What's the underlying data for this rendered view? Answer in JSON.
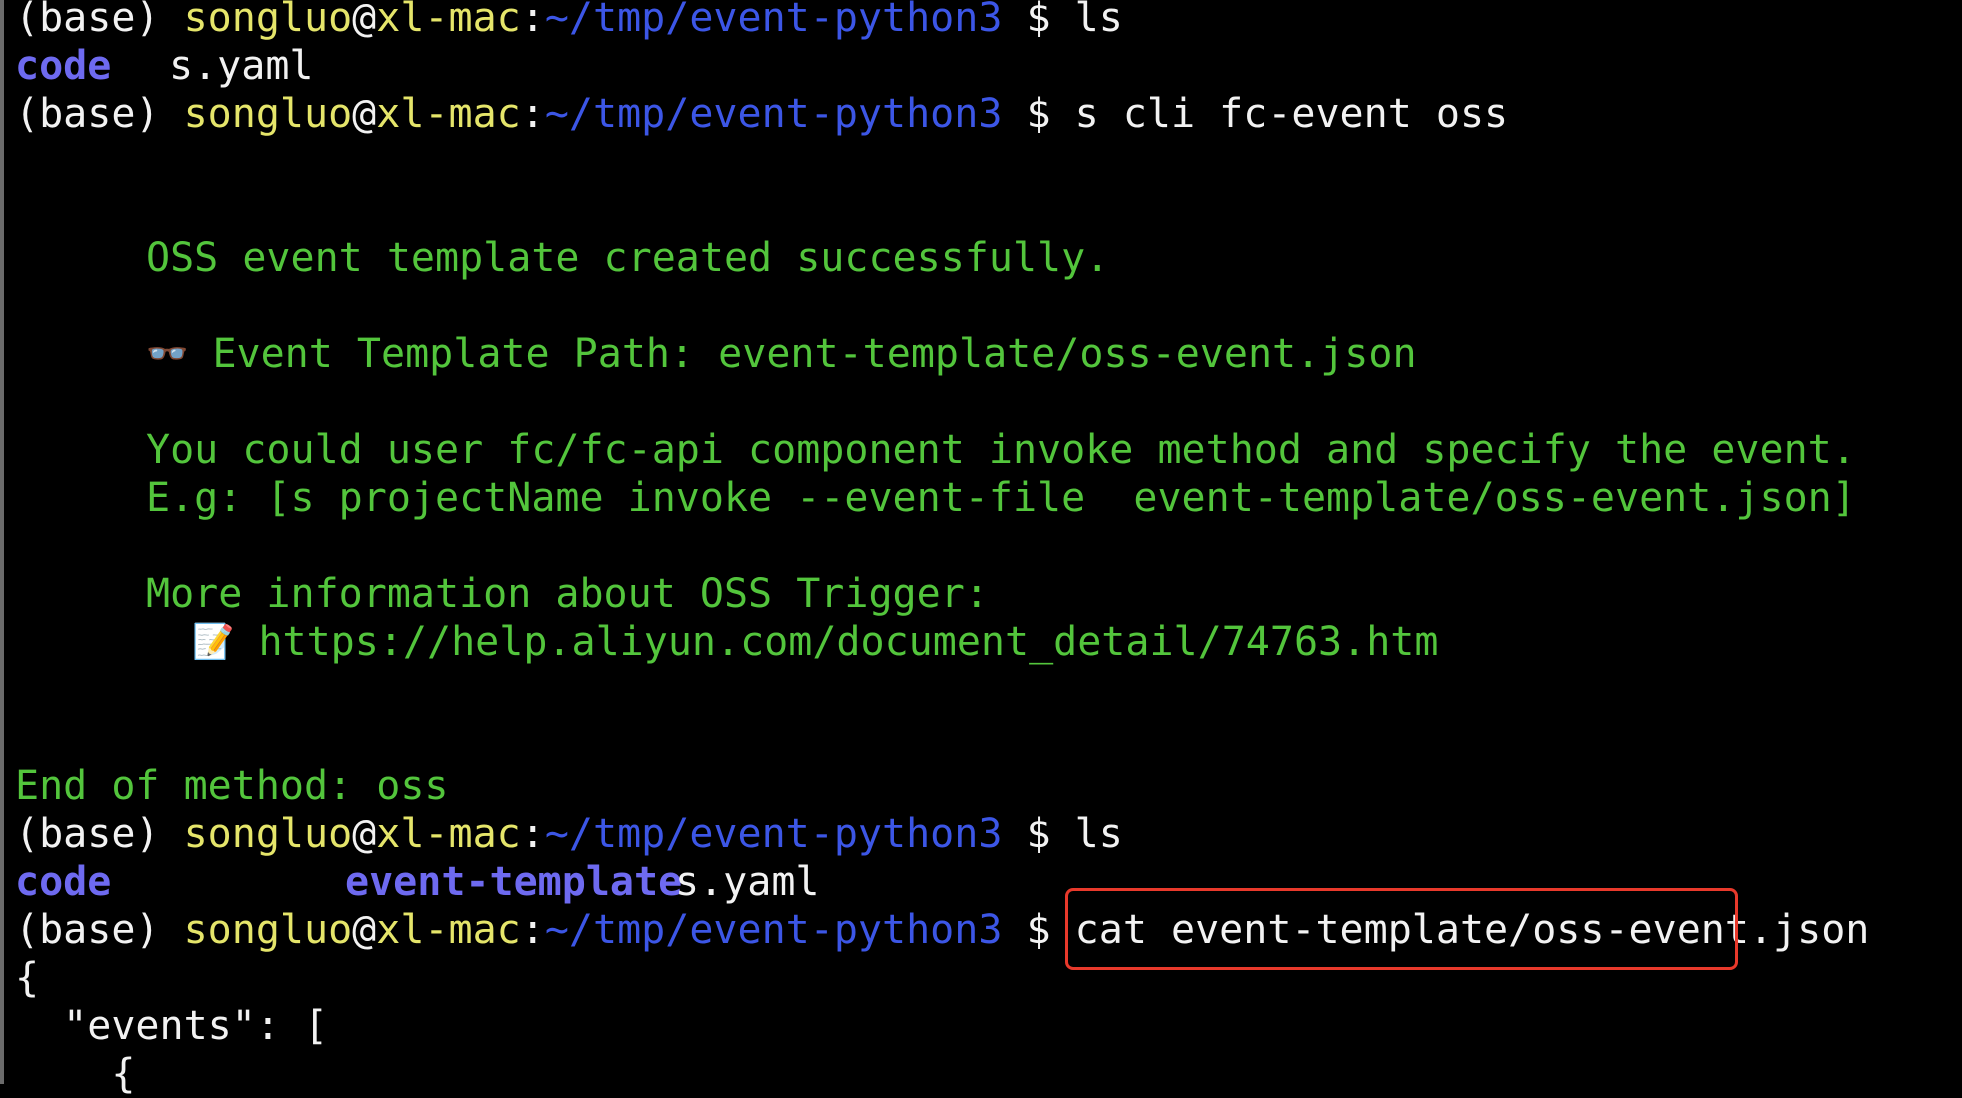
{
  "terminal": {
    "prompt": {
      "env": "(base) ",
      "user": "songluo",
      "at": "@",
      "host": "xl-mac",
      "colon": ":",
      "path": "~/tmp/event-python3",
      "symbol": " $ "
    },
    "commands": {
      "ls_1": "ls",
      "cli": "s cli fc-event oss",
      "ls_2": "ls",
      "cat_prefix": "cat ",
      "cat_arg": "event-template/oss-event.json"
    },
    "listing_1": {
      "dir": "code",
      "file": "s.yaml"
    },
    "output": {
      "success": "OSS event template created successfully.",
      "path_emoji": "👓",
      "path_line": "Event Template Path: event-template/oss-event.json",
      "invoke_line": "You could user fc/fc-api component invoke method and specify the event.",
      "example_line": "E.g: [s projectName invoke --event-file  event-template/oss-event.json]",
      "more_info": "More information about OSS Trigger:",
      "memo_emoji": "📝",
      "url": "https://help.aliyun.com/document_detail/74763.htm",
      "end": "End of method: oss"
    },
    "listing_2": {
      "dir_1": "code",
      "dir_2": "event-template",
      "file": "s.yaml"
    },
    "json": {
      "open_brace": "{",
      "events_key": "  \"events\": [",
      "inner_brace": "    {"
    }
  },
  "colors": {
    "background": "#000000",
    "text": "#f2f2f2",
    "user": "#e5e56a",
    "path": "#3c56e6",
    "directory": "#6e6af0",
    "output": "#53c53c",
    "highlight": "#e8392b"
  }
}
